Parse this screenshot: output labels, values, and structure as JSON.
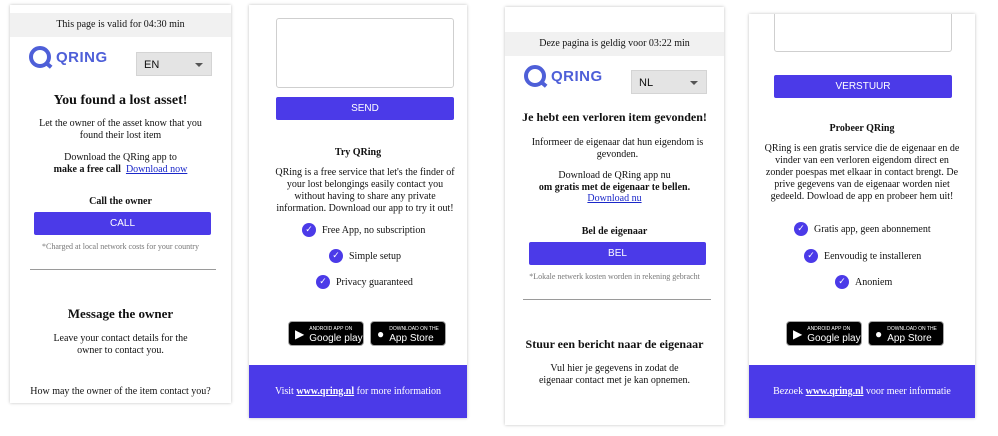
{
  "panel1": {
    "timer": "This page is valid for 04:30 min",
    "logo": "QRING",
    "language": "EN",
    "title": "You found a lost asset!",
    "intro": "Let the owner of the asset know that you found their lost item",
    "download_line1": "Download the QRing app to",
    "download_bold": "make a free call",
    "download_link": "Download now",
    "call_heading": "Call the owner",
    "call_button": "CALL",
    "call_note": "*Charged at local network costs for your country",
    "message_title": "Message the owner",
    "message_text": "Leave your contact details for the owner to contact you.",
    "question": "How may the owner of the item contact you?"
  },
  "panel2": {
    "send_button": "SEND",
    "try_heading": "Try QRing",
    "try_text": "QRing is a free service that let's the finder of your lost belongings easily contact you without having to share any private information. Download our app to try it out!",
    "features": [
      "Free App, no subscription",
      "Simple setup",
      "Privacy guaranteed"
    ],
    "google_small": "Android app on",
    "google_big": "Google play",
    "apple_small": "Download on the",
    "apple_big": "App Store",
    "footer_pre": "Visit",
    "footer_link": "www.qring.nl",
    "footer_post": "for more information"
  },
  "panel3": {
    "timer": "Deze pagina is geldig voor 03:22 min",
    "logo": "QRING",
    "language": "NL",
    "title": "Je hebt een verloren item gevonden!",
    "intro": "Informeer de eigenaar dat hun eigendom is gevonden.",
    "download_line1": "Download de QRing app nu",
    "download_bold": "om gratis met de eigenaar te bellen.",
    "download_link": "Download nu",
    "call_heading": "Bel de eigenaar",
    "call_button": "BEL",
    "call_note": "*Lokale netwerk kosten worden in rekening gebracht",
    "message_title": "Stuur een bericht naar de eigenaar",
    "message_text": "Vul hier je gegevens in zodat de eigenaar contact met je kan opnemen."
  },
  "panel4": {
    "send_button": "VERSTUUR",
    "try_heading": "Probeer QRing",
    "try_text": "QRing is een gratis service die de eigenaar en de vinder van een verloren eigendom direct en zonder poespas met elkaar in contact brengt. De prive gegevens van de eigenaar worden niet gedeeld. Dowload de app en probeer hem uit!",
    "features": [
      "Gratis app, geen abonnement",
      "Eenvoudig te installeren",
      "Anoniem"
    ],
    "google_small": "Android app on",
    "google_big": "Google play",
    "apple_small": "Download on the",
    "apple_big": "App Store",
    "footer_pre": "Bezoek",
    "footer_link": "www.qring.nl",
    "footer_post": "voor meer informatie"
  },
  "colors": {
    "accent": "#4b3ae8",
    "logo": "#4e5fd8",
    "link": "#1a27c9"
  },
  "icons": [
    "qring-logo-icon",
    "chevron-down-icon",
    "check-icon",
    "google-play-icon",
    "apple-icon"
  ]
}
